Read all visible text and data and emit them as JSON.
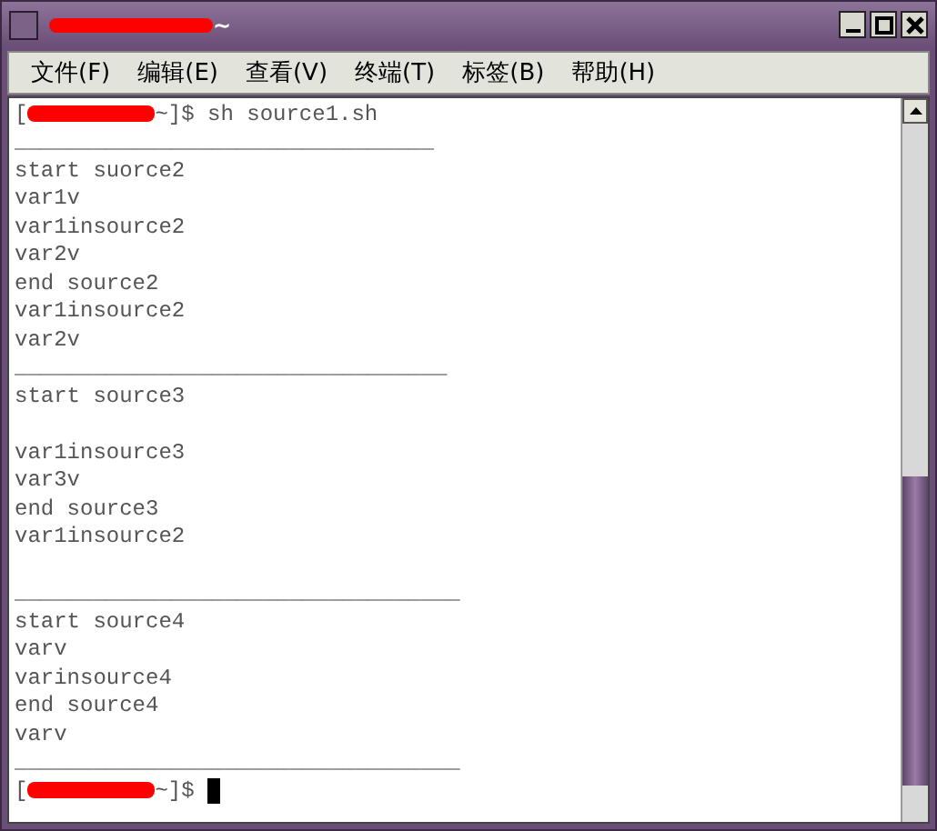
{
  "window": {
    "title": {
      "redacted": true,
      "text": "~"
    }
  },
  "menu": [
    {
      "label": "文件(F)"
    },
    {
      "label": "编辑(E)"
    },
    {
      "label": "查看(V)"
    },
    {
      "label": "终端(T)"
    },
    {
      "label": "标签(B)"
    },
    {
      "label": "帮助(H)"
    }
  ],
  "terminal": {
    "lines": [
      {
        "kind": "prompt",
        "before": "[",
        "redacted": true,
        "after": "~]$ sh source1.sh"
      },
      {
        "kind": "text",
        "text": "________________________________"
      },
      {
        "kind": "text",
        "text": "start suorce2"
      },
      {
        "kind": "text",
        "text": "var1v"
      },
      {
        "kind": "text",
        "text": "var1insource2"
      },
      {
        "kind": "text",
        "text": "var2v"
      },
      {
        "kind": "text",
        "text": "end source2"
      },
      {
        "kind": "text",
        "text": "var1insource2"
      },
      {
        "kind": "text",
        "text": "var2v"
      },
      {
        "kind": "text",
        "text": "_________________________________"
      },
      {
        "kind": "text",
        "text": "start source3"
      },
      {
        "kind": "blank"
      },
      {
        "kind": "text",
        "text": "var1insource3"
      },
      {
        "kind": "text",
        "text": "var3v"
      },
      {
        "kind": "text",
        "text": "end source3"
      },
      {
        "kind": "text",
        "text": "var1insource2"
      },
      {
        "kind": "blank"
      },
      {
        "kind": "text",
        "text": "__________________________________"
      },
      {
        "kind": "text",
        "text": "start source4"
      },
      {
        "kind": "text",
        "text": "varv"
      },
      {
        "kind": "text",
        "text": "varinsource4"
      },
      {
        "kind": "text",
        "text": "end source4"
      },
      {
        "kind": "text",
        "text": "varv"
      },
      {
        "kind": "text",
        "text": "__________________________________"
      },
      {
        "kind": "prompt",
        "before": "[",
        "redacted": true,
        "after": "~]$",
        "cursor": true
      }
    ]
  }
}
